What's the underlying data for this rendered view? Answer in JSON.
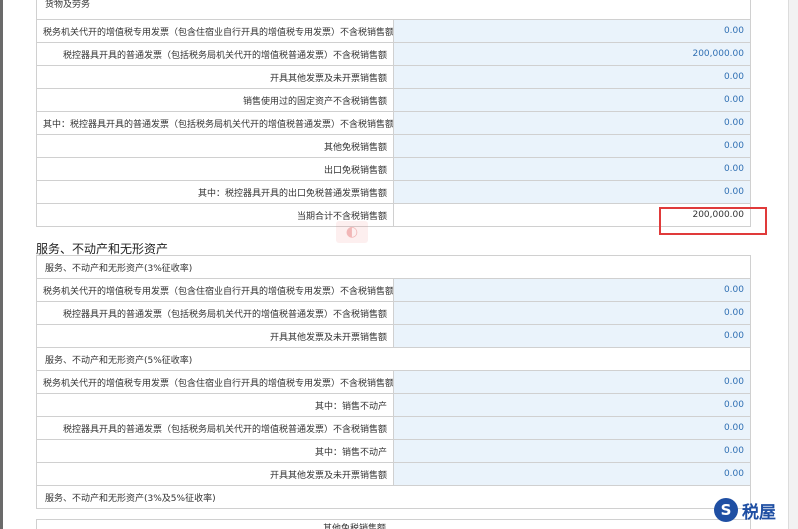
{
  "goods": {
    "header": "货物及劳务",
    "rows": [
      {
        "label": "税务机关代开的增值税专用发票（包含住宿业自行开具的增值税专用发票）不含税销售额",
        "value": "0.00"
      },
      {
        "label": "税控器具开具的普通发票（包括税务局机关代开的增值税普通发票）不含税销售额",
        "value": "200,000.00"
      },
      {
        "label": "开具其他发票及未开票销售额",
        "value": "0.00"
      },
      {
        "label": "销售使用过的固定资产不含税销售额",
        "value": "0.00"
      },
      {
        "label": "其中：税控器具开具的普通发票（包括税务局机关代开的增值税普通发票）不含税销售额",
        "value": "0.00"
      },
      {
        "label": "其他免税销售额",
        "value": "0.00"
      },
      {
        "label": "出口免税销售额",
        "value": "0.00"
      },
      {
        "label": "其中：税控器具开具的出口免税普通发票销售额",
        "value": "0.00"
      },
      {
        "label": "当期合计不含税销售额",
        "value": "200,000.00"
      }
    ]
  },
  "services": {
    "title": "服务、不动产和无形资产",
    "group3": {
      "header": "服务、不动产和无形资产(3%征收率)",
      "rows": [
        {
          "label": "税务机关代开的增值税专用发票（包含住宿业自行开具的增值税专用发票）不含税销售额",
          "value": "0.00"
        },
        {
          "label": "税控器具开具的普通发票（包括税务局机关代开的增值税普通发票）不含税销售额",
          "value": "0.00"
        },
        {
          "label": "开具其他发票及未开票销售额",
          "value": "0.00"
        }
      ]
    },
    "group5": {
      "header": "服务、不动产和无形资产(5%征收率)",
      "rows": [
        {
          "label": "税务机关代开的增值税专用发票（包含住宿业自行开具的增值税专用发票）不含税销售额",
          "value": "0.00"
        },
        {
          "label": "其中：销售不动产",
          "value": "0.00"
        },
        {
          "label": "税控器具开具的普通发票（包括税务局机关代开的增值税普通发票）不含税销售额",
          "value": "0.00"
        },
        {
          "label": "其中：销售不动产",
          "value": "0.00"
        },
        {
          "label": "开具其他发票及未开票销售额",
          "value": "0.00"
        }
      ]
    },
    "group35": {
      "header": "服务、不动产和无形资产(3%及5%征收率)",
      "partial_label": "其他免税销售额"
    }
  },
  "logo": {
    "text": "税屋",
    "mark": "S"
  },
  "colors": {
    "value_text": "#2f6fb3",
    "input_bg": "#eaf3fb",
    "highlight_border": "#e03a3a",
    "logo": "#1f4fa3"
  }
}
